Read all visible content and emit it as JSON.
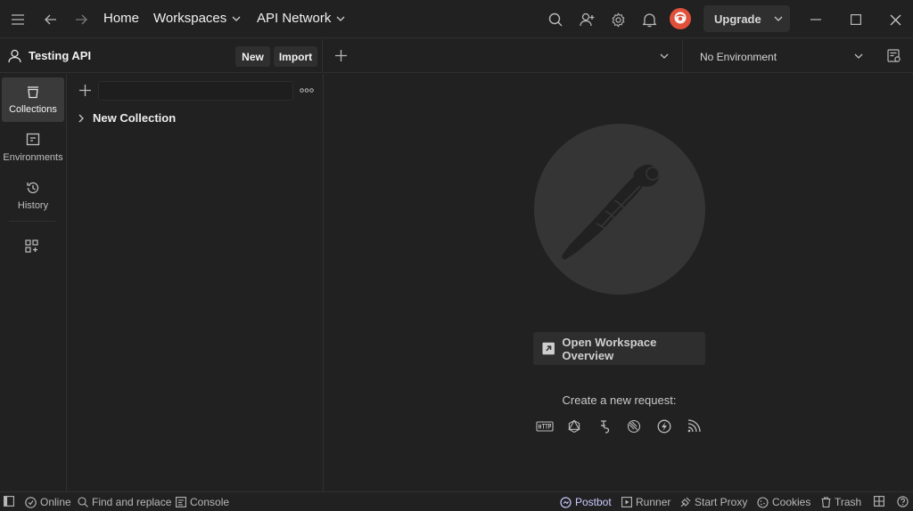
{
  "titlebar": {
    "nav": {
      "home": "Home",
      "workspaces": "Workspaces",
      "api_network": "API Network"
    },
    "upgrade_label": "Upgrade",
    "icons": [
      "menu-icon",
      "back-arrow-icon",
      "forward-arrow-icon",
      "search-icon",
      "invite-user-icon",
      "settings-icon",
      "notifications-icon",
      "avatar",
      "minimize-icon",
      "maximize-icon",
      "close-icon"
    ]
  },
  "workspace": {
    "name": "Testing API",
    "new_label": "New",
    "import_label": "Import"
  },
  "environment": {
    "selected": "No Environment"
  },
  "sidebar": {
    "items": [
      {
        "label": "Collections",
        "icon": "collections-icon",
        "active": true
      },
      {
        "label": "Environments",
        "icon": "environments-icon",
        "active": false
      },
      {
        "label": "History",
        "icon": "history-icon",
        "active": false
      }
    ]
  },
  "collections": {
    "search_placeholder": "",
    "items": [
      {
        "label": "New Collection"
      }
    ]
  },
  "main": {
    "overview_label": "Open Workspace Overview",
    "create_text": "Create a new request:",
    "request_types": [
      "http-icon",
      "graphql-icon",
      "grpc-icon",
      "websocket-icon",
      "socketio-icon",
      "mqtt-icon"
    ]
  },
  "statusbar": {
    "online": "Online",
    "find_replace": "Find and replace",
    "console": "Console",
    "postbot": "Postbot",
    "runner": "Runner",
    "start_proxy": "Start Proxy",
    "cookies": "Cookies",
    "trash": "Trash"
  },
  "colors": {
    "background": "#212121",
    "panel": "#2f2f2f",
    "avatar": "#e0503a",
    "postbot": "#c9c9ff"
  }
}
